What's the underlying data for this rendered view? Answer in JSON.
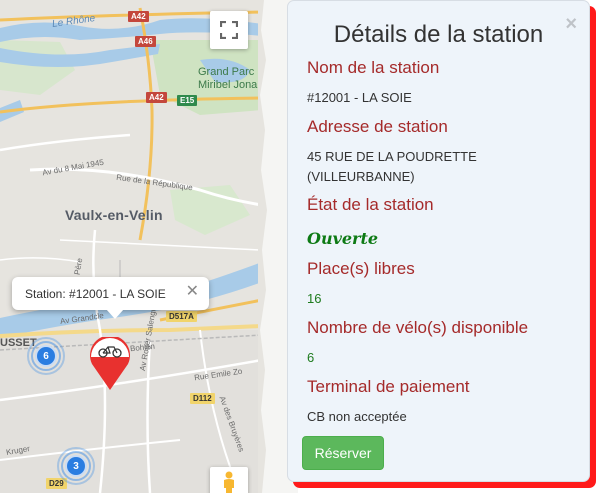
{
  "map": {
    "labels": {
      "rhone": "Le Rhône",
      "park": "Grand Parc Miribel Jonage",
      "park_line1": "Grand Parc",
      "park_line2": "Miribel Jona",
      "city": "Vaulx-en-Velin",
      "street_8mai": "Av du 8 Mai 1945",
      "street_republique": "Rue de la République",
      "street_grandclement": "Av Grandcle",
      "street_bohlen": "Bohlen",
      "street_salengro": "Av Roger Salengro",
      "street_zola": "Rue Emile Zo",
      "street_bruyeres": "Av des Bruyères",
      "street_pere": "Père",
      "street_kruger": "Kruger",
      "ousset": "USSET"
    },
    "road_badges": {
      "a42_top": "A42",
      "a46": "A46",
      "a42_mid": "A42",
      "e15": "E15",
      "d517a": "D517A",
      "d112": "D112",
      "d29": "D29"
    },
    "info_window": {
      "text": "Station: #12001 - LA SOIE",
      "close": "✕"
    },
    "clusters": [
      {
        "count": "6"
      },
      {
        "count": "3"
      }
    ],
    "icons": {
      "fullscreen": "fullscreen-icon",
      "pegman": "street-view-pegman-icon",
      "marker": "bike-station-marker-icon"
    },
    "colors": {
      "water": "#a8cbe8",
      "park": "#c8dfb9",
      "marker": "#e8312f",
      "cluster": "#2a7de1"
    }
  },
  "panel": {
    "title": "Détails de la station",
    "close": "×",
    "fields": {
      "name_label": "Nom de la station",
      "name_value": "#12001 - LA SOIE",
      "address_label": "Adresse de station",
      "address_line1": "45 RUE DE LA POUDRETTE",
      "address_line2": "(VILLEURBANNE)",
      "state_label": "État de la station",
      "state_value": "Ouverte",
      "free_label": "Place(s) libres",
      "free_value": "16",
      "bikes_label": "Nombre de vélo(s) disponible",
      "bikes_value": "6",
      "payment_label": "Terminal de paiement",
      "payment_value": "CB non acceptée"
    },
    "reserve_button": "Réserver",
    "colors": {
      "label": "#a52a2a",
      "open_status": "#0d7a14",
      "shadow": "#ff1a1a",
      "button": "#5cb85c"
    }
  }
}
